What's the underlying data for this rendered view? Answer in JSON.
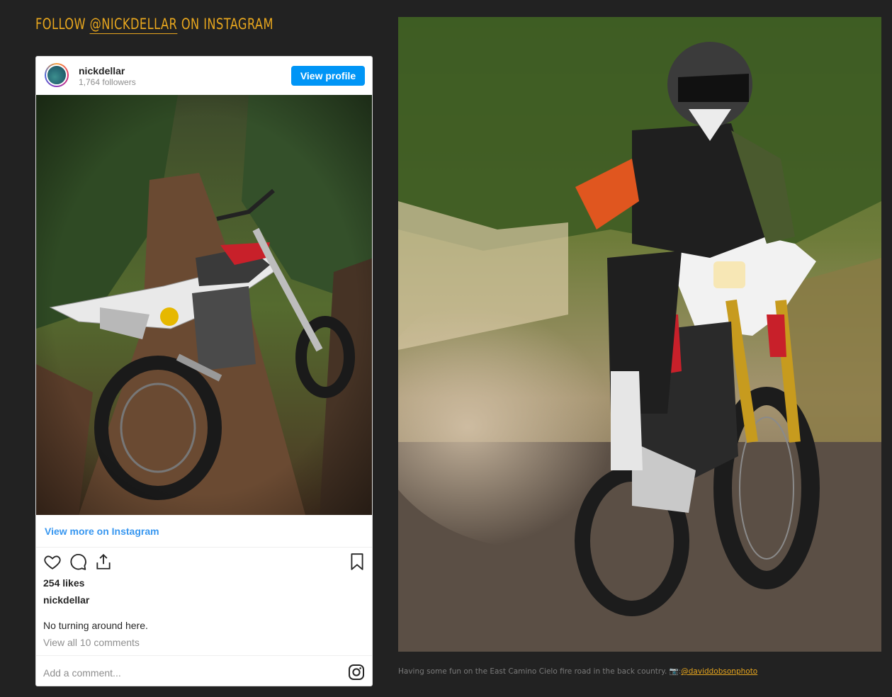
{
  "heading": {
    "prefix": "FOLLOW ",
    "handle": "@NICKDELLAR",
    "suffix": " ON INSTAGRAM"
  },
  "instagram": {
    "username": "nickdellar",
    "followers": "1,764 followers",
    "view_profile": "View profile",
    "photo_icon": "dirt-bike-on-trail-image",
    "view_more": "View more on Instagram",
    "likes": "254 likes",
    "owner": "nickdellar",
    "caption": "No turning around here.",
    "comments_link": "View all 10 comments",
    "add_comment_placeholder": "Add a comment...",
    "icons": [
      "heart-icon",
      "comment-icon",
      "share-icon",
      "bookmark-icon",
      "instagram-logo-icon"
    ]
  },
  "hero": {
    "image": "rider-on-dirt-bike-photo",
    "caption": "Having some fun on the East Camino Cielo fire road in the back country. 📷:",
    "credit": "@daviddobsonphoto"
  },
  "colors": {
    "background": "#222222",
    "accent": "#e7a61e",
    "ig_blue": "#0095f6"
  }
}
